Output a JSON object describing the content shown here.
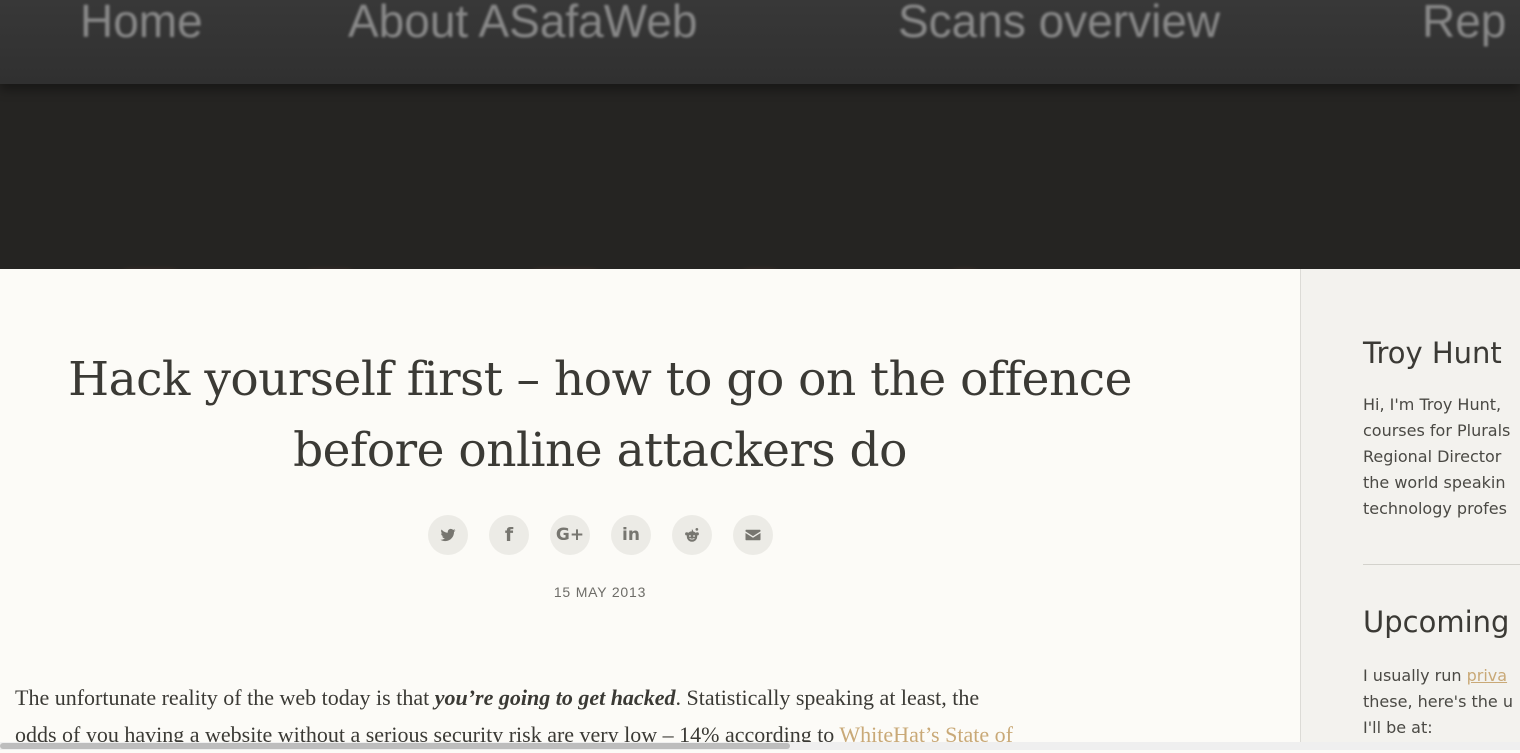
{
  "nav": {
    "items": [
      "Home",
      "About ASafaWeb",
      "Scans overview",
      "Rep"
    ]
  },
  "post": {
    "title_line1": "Hack yourself first – how to go on the offence",
    "title_line2": "before online attackers do",
    "date": "15 MAY 2013",
    "share_icons": [
      "twitter-icon",
      "facebook-icon",
      "google-plus-icon",
      "linkedin-icon",
      "reddit-icon",
      "email-icon"
    ],
    "share_glyphs": {
      "google_plus": "G+",
      "linkedin": "in",
      "facebook": "f"
    },
    "body": {
      "p1_pre": "The unfortunate reality of the web today is that ",
      "p1_em": "you’re going to get hacked",
      "p1_post": ". Statistically speaking at least, the",
      "p2_pre": "odds of you having a website without a serious security risk are very low – 14% according to ",
      "p2_link": "WhiteHat’s State of"
    }
  },
  "sidebar": {
    "author_heading": "Troy Hunt",
    "author_lines": [
      "Hi, I'm Troy Hunt,",
      "courses for Plurals",
      "Regional Director",
      "the world speakin",
      "technology profes"
    ],
    "upcoming_heading": "Upcoming",
    "upcoming_line1_pre": "I usually run ",
    "upcoming_line1_link": "priva",
    "upcoming_line2": "these, here's the u",
    "upcoming_line3": "I'll be at:"
  },
  "colors": {
    "accent": "#c9a977",
    "text": "#3b3a35",
    "nav_bg": "#333333",
    "hero_bg": "#252422",
    "page_bg": "#fcfbf7"
  }
}
